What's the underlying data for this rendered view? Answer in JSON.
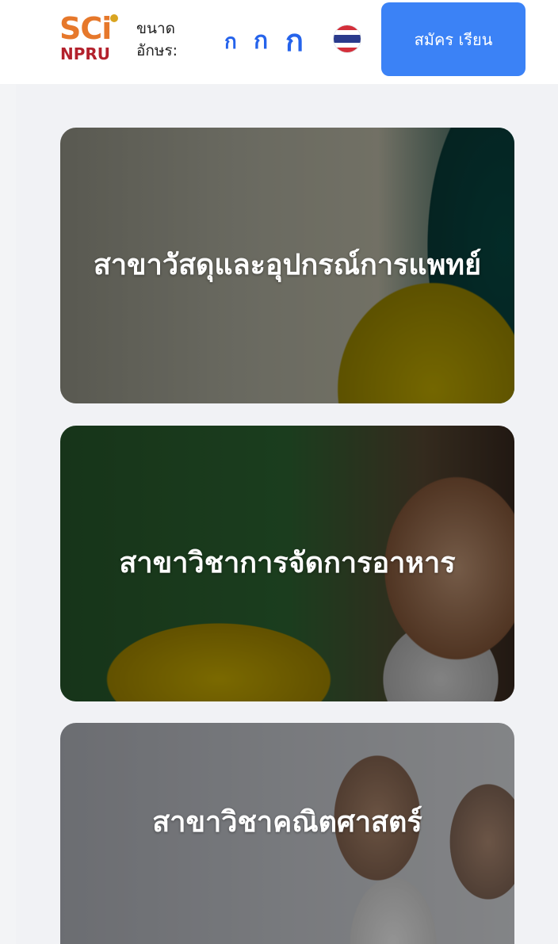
{
  "header": {
    "logo_text_top": "SCi",
    "logo_text_bottom": "NPRU",
    "font_size_label": "ขนาด อักษร:",
    "font_size_options": [
      "ก",
      "ก",
      "ก"
    ],
    "language_flag": "thailand-flag-icon",
    "apply_button_label": "สมัคร เรียน",
    "accent_color": "#3b82f6"
  },
  "programs": [
    {
      "title": "สาขาวัสดุและอุปกรณ์การแพทย์"
    },
    {
      "title": "สาขาวิชาการจัดการอาหาร"
    },
    {
      "title": "สาขาวิชาคณิตศาสตร์"
    }
  ]
}
